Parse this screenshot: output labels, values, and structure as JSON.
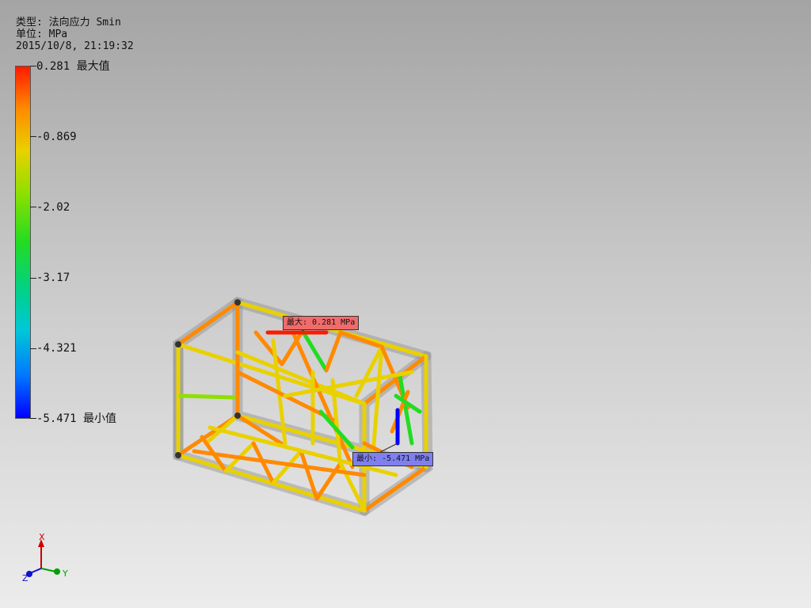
{
  "header": {
    "type_line": "类型: 法向应力 Smin",
    "unit_line": "单位: MPa",
    "date_line": "2015/10/8, 21:19:32"
  },
  "legend": {
    "labels": [
      "0.281 最大值",
      "-0.869",
      "-2.02",
      "-3.17",
      "-4.321",
      "-5.471 最小值"
    ],
    "colors": [
      "#ff1a00",
      "#ff8a00",
      "#e9d100",
      "#22dc22",
      "#00c8d8",
      "#0000ff"
    ]
  },
  "probes": {
    "max_label": "最大: 0.281 MPa",
    "min_label": "最小: -5.471 MPa"
  },
  "triad": {
    "x": "X",
    "y": "Y",
    "z": "Z"
  },
  "icons": [
    "triad-icon",
    "probe-max-icon",
    "probe-min-icon"
  ]
}
